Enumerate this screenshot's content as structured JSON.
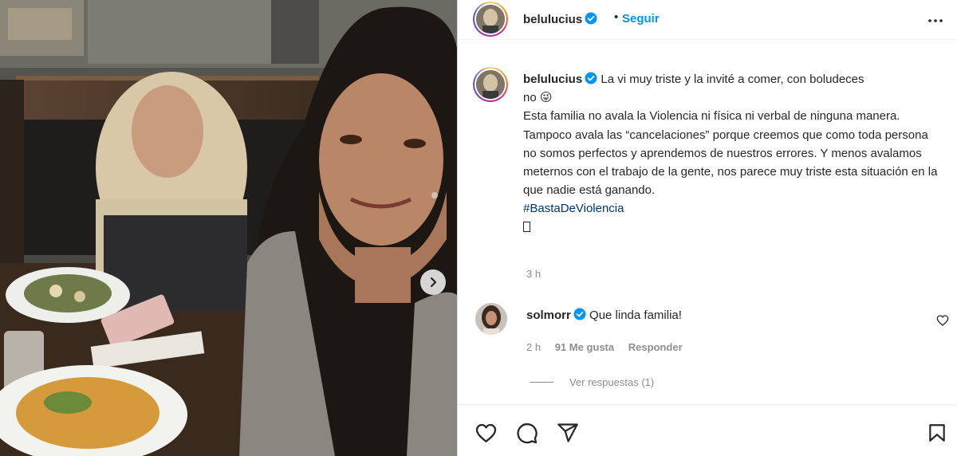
{
  "post": {
    "username": "belulucius",
    "follow_label": "Seguir",
    "dot": "•",
    "caption": {
      "username": "belulucius",
      "line1": "La vi muy triste y la invité a comer, con boludeces",
      "line1b": "no",
      "emoji": "😜",
      "body": "Esta familia no avala la Violencia ni física ni verbal de ninguna manera. Tampoco avala las “cancelaciones” porque creemos que como toda persona no somos perfectos y aprendemos de nuestros errores. Y menos avalamos meternos con el trabajo de la gente, nos parece muy triste esta situación en la que nadie está ganando.",
      "hashtag": "#BastaDeViolencia",
      "time": "3 h"
    },
    "comment": {
      "username": "solmorr",
      "text": "Que linda familia!",
      "time": "2 h",
      "likes": "91 Me gusta",
      "reply_label": "Responder",
      "view_replies": "Ver respuestas (1)"
    }
  },
  "icons": {
    "verified": "verified-badge-icon",
    "more": "more-options-icon",
    "next": "chevron-right-icon",
    "like": "heart-icon",
    "comment": "comment-icon",
    "share": "share-icon",
    "save": "bookmark-icon"
  },
  "colors": {
    "accent": "#0095f6",
    "verified": "#0095f6",
    "hashtag": "#00376b",
    "muted": "#8e8e8e",
    "text": "#262626"
  }
}
